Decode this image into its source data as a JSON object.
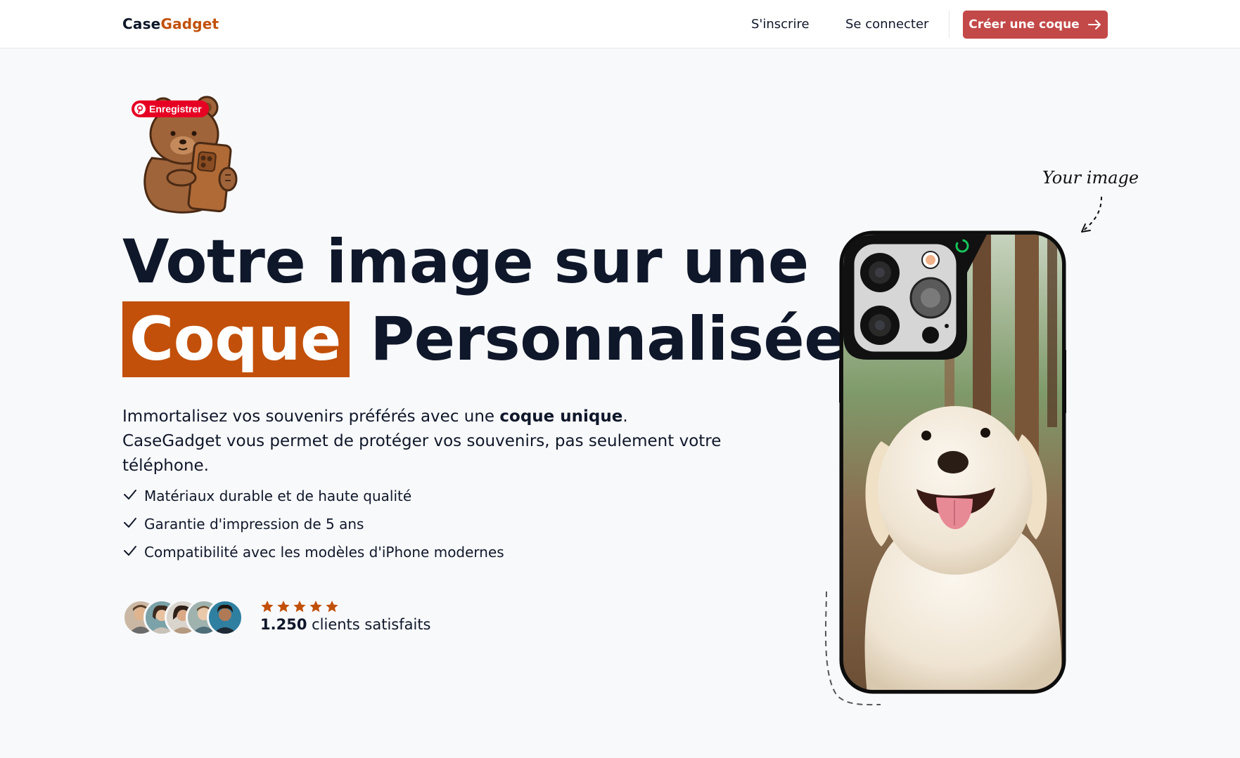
{
  "nav": {
    "logo_part1": "Case",
    "logo_part2": "Gadget",
    "signup": "S'inscrire",
    "login": "Se connecter",
    "cta": "Créer une coque"
  },
  "pinterest": {
    "label": "Enregistrer"
  },
  "hero": {
    "headline_line1": "Votre image sur une",
    "headline_highlight": "Coque",
    "headline_line2_rest": "Personnalisée",
    "lead_part1": "Immortalisez vos souvenirs préférés avec une ",
    "lead_bold": "coque unique",
    "lead_part2": ". CaseGadget vous permet de protéger vos souvenirs, pas seulement votre téléphone.",
    "features": [
      "Matériaux durable et de haute qualité",
      "Garantie d'impression de 5 ans",
      "Compatibilité avec les modèles d'iPhone modernes"
    ],
    "rating_count": "1.250",
    "rating_label": " clients satisfaits",
    "rating_stars": 5,
    "annotation": "Your image"
  },
  "colors": {
    "brand_orange": "#c2500a",
    "cta_red": "#c34848",
    "text_dark": "#0f172a",
    "pinterest_red": "#e60023"
  },
  "icons": {
    "cta_arrow": "arrow-right-icon",
    "feature_check": "check-icon",
    "star": "star-icon"
  }
}
